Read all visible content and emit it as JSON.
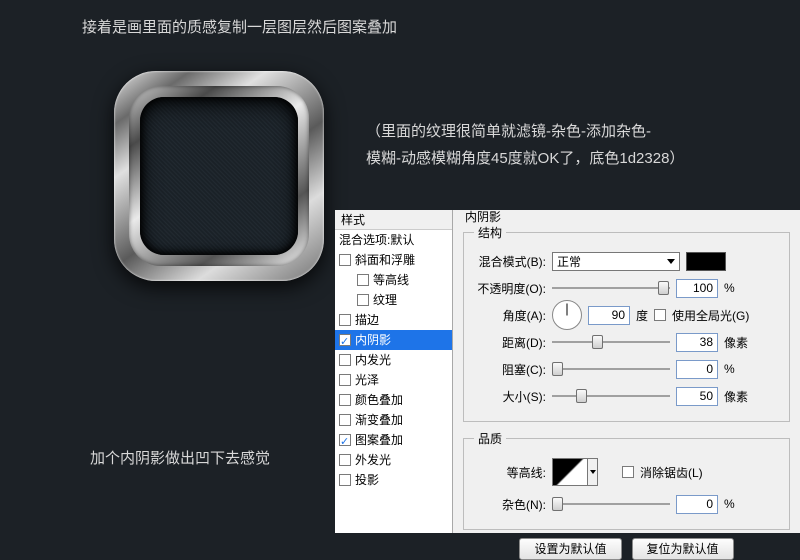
{
  "captions": {
    "top": "接着是画里面的质感复制一层图层然后图案叠加",
    "right_line1": "（里面的纹理很简单就滤镜-杂色-添加杂色-",
    "right_line2": "模糊-动感模糊角度45度就OK了，底色1d2328）",
    "bottom": "加个内阴影做出凹下去感觉"
  },
  "styles": {
    "header": "样式",
    "blendDefault": "混合选项:默认",
    "bevel": "斜面和浮雕",
    "contour": "等高线",
    "texture": "纹理",
    "stroke": "描边",
    "innerShadow": "内阴影",
    "innerGlow": "内发光",
    "satin": "光泽",
    "colorOverlay": "颜色叠加",
    "gradientOverlay": "渐变叠加",
    "patternOverlay": "图案叠加",
    "outerGlow": "外发光",
    "dropShadow": "投影"
  },
  "settings": {
    "title": "内阴影",
    "group_structure": "结构",
    "group_quality": "品质",
    "blendMode_label": "混合模式(B):",
    "blendMode_value": "正常",
    "opacity_label": "不透明度(O):",
    "opacity_value": "100",
    "opacity_unit": "%",
    "angle_label": "角度(A):",
    "angle_value": "90",
    "angle_unit": "度",
    "useGlobal_label": "使用全局光(G)",
    "distance_label": "距离(D):",
    "distance_value": "38",
    "distance_unit": "像素",
    "choke_label": "阻塞(C):",
    "choke_value": "0",
    "choke_unit": "%",
    "size_label": "大小(S):",
    "size_value": "50",
    "size_unit": "像素",
    "contour_label": "等高线:",
    "antialias_label": "消除锯齿(L)",
    "noise_label": "杂色(N):",
    "noise_value": "0",
    "noise_unit": "%",
    "btn_default": "设置为默认值",
    "btn_reset": "复位为默认值"
  }
}
